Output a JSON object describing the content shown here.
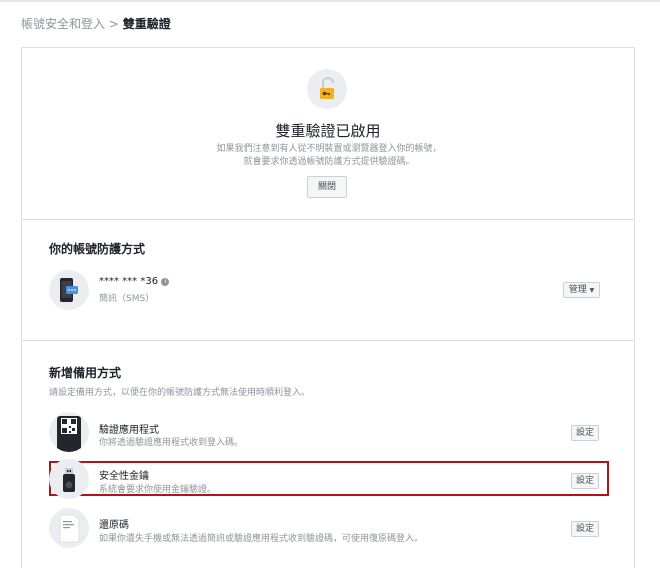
{
  "breadcrumb": {
    "parent": "帳號安全和登入",
    "separator": ">",
    "current": "雙重驗證"
  },
  "status": {
    "title": "雙重驗證已啟用",
    "description": "如果我們注意到有人從不明裝置或瀏覽器登入你的帳號，就會要求你透過帳號防護方式提供驗證碼。",
    "off_button": "關閉"
  },
  "protection": {
    "heading": "你的帳號防護方式",
    "method_number": "**** *** *36",
    "method_type": "簡訊（SMS）",
    "manage_button": "管理"
  },
  "backup": {
    "heading": "新增備用方式",
    "subtitle": "請設定備用方式，以便在你的帳號防護方式無法使用時順利登入。",
    "items": [
      {
        "name": "驗證應用程式",
        "desc": "你將透過驗證應用程式收到登入碼。",
        "button": "設定",
        "icon": "qr-code-phone-icon"
      },
      {
        "name": "安全性金鑰",
        "desc": "系統會要求你使用金鑰驗證。",
        "button": "設定",
        "icon": "usb-security-key-icon"
      },
      {
        "name": "還原碼",
        "desc": "如果你遺失手機或無法透過簡訊或驗證應用程式收到驗證碼，可使用復原碼登入。",
        "button": "設定",
        "icon": "recovery-code-document-icon"
      }
    ]
  },
  "colors": {
    "highlight": "#b0141a",
    "lock": "#f5b021",
    "sms_blue": "#4a90e2"
  }
}
